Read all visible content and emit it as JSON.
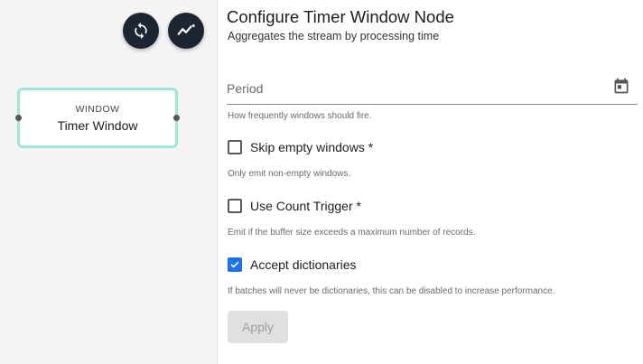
{
  "canvas": {
    "refresh_icon": "refresh-icon",
    "trend_icon": "trend-icon",
    "node": {
      "type": "WINDOW",
      "name": "Timer Window",
      "border_color": "#9ee6d7"
    }
  },
  "panel": {
    "title": "Configure Timer Window Node",
    "subtitle": "Aggregates the stream by processing time",
    "period": {
      "placeholder": "Period",
      "value": "",
      "hint": "How frequently windows should fire."
    },
    "options": [
      {
        "label": "Skip empty windows *",
        "checked": false,
        "hint": "Only emit non-empty windows."
      },
      {
        "label": "Use Count Trigger *",
        "checked": false,
        "hint": "Emit if the buffer size exceeds a maximum number of records."
      },
      {
        "label": "Accept dictionaries",
        "checked": true,
        "hint": "If batches will never be dictionaries, this can be disabled to increase performance."
      }
    ],
    "apply_label": "Apply",
    "accent_color": "#1a73e8"
  }
}
